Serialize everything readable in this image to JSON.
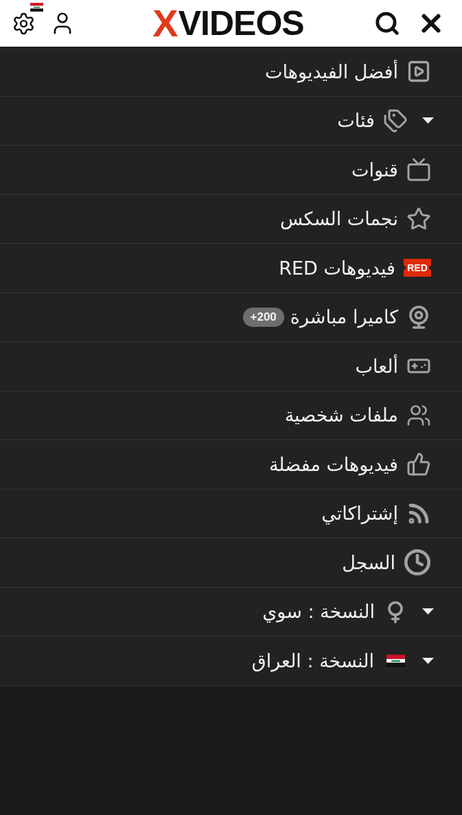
{
  "header": {
    "logo": {
      "mark": "X",
      "name": "VIDEOS"
    }
  },
  "menu": [
    {
      "label": "أفضل الفيديوهات",
      "kind": "link"
    },
    {
      "label": "فئات",
      "kind": "dropdown"
    },
    {
      "label": "قنوات",
      "kind": "link"
    },
    {
      "label": "نجمات السكس",
      "kind": "link"
    },
    {
      "label": "فيديوهات RED",
      "kind": "link",
      "tag": "RED"
    },
    {
      "label": "كاميرا مباشرة",
      "kind": "link",
      "badge": "+200"
    },
    {
      "label": "ألعاب",
      "kind": "link"
    },
    {
      "label": "ملفات شخصية",
      "kind": "link"
    },
    {
      "label": "فيديوهات مفضلة",
      "kind": "link"
    },
    {
      "label": "إشتراكاتي",
      "kind": "link"
    },
    {
      "label": "السجل",
      "kind": "link"
    },
    {
      "label": "النسخة : سوي",
      "kind": "dropdown"
    },
    {
      "label": "النسخة : العراق",
      "kind": "dropdown"
    }
  ]
}
